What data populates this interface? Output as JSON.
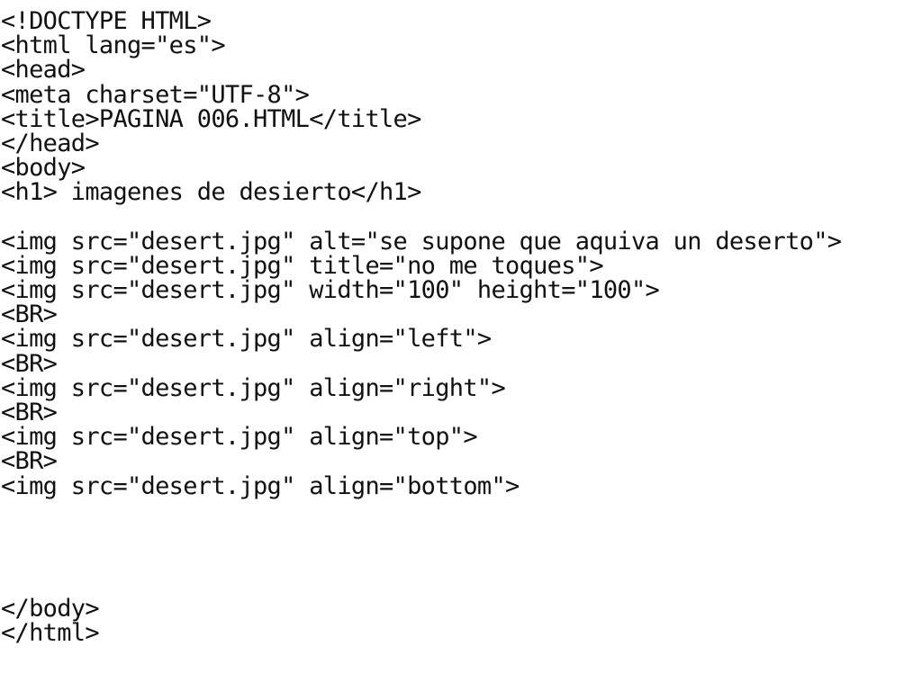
{
  "editor": {
    "lines": [
      "<!DOCTYPE HTML>",
      "<html lang=\"es\">",
      "<head>",
      "<meta charset=\"UTF-8\">",
      "<title>PAGINA 006.HTML</title>",
      "</head>",
      "<body>",
      "<h1> imagenes de desierto</h1>",
      "",
      "<img src=\"desert.jpg\" alt=\"se supone que aquiva un deserto\">",
      "<img src=\"desert.jpg\" title=\"no me toques\">",
      "<img src=\"desert.jpg\" width=\"100\" height=\"100\">",
      "<BR>",
      "<img src=\"desert.jpg\" align=\"left\">",
      "<BR>",
      "<img src=\"desert.jpg\" align=\"right\">",
      "<BR>",
      "<img src=\"desert.jpg\" align=\"top\">",
      "<BR>",
      "<img src=\"desert.jpg\" align=\"bottom\">",
      "",
      "",
      "",
      "",
      "</body>",
      "</html>"
    ]
  }
}
